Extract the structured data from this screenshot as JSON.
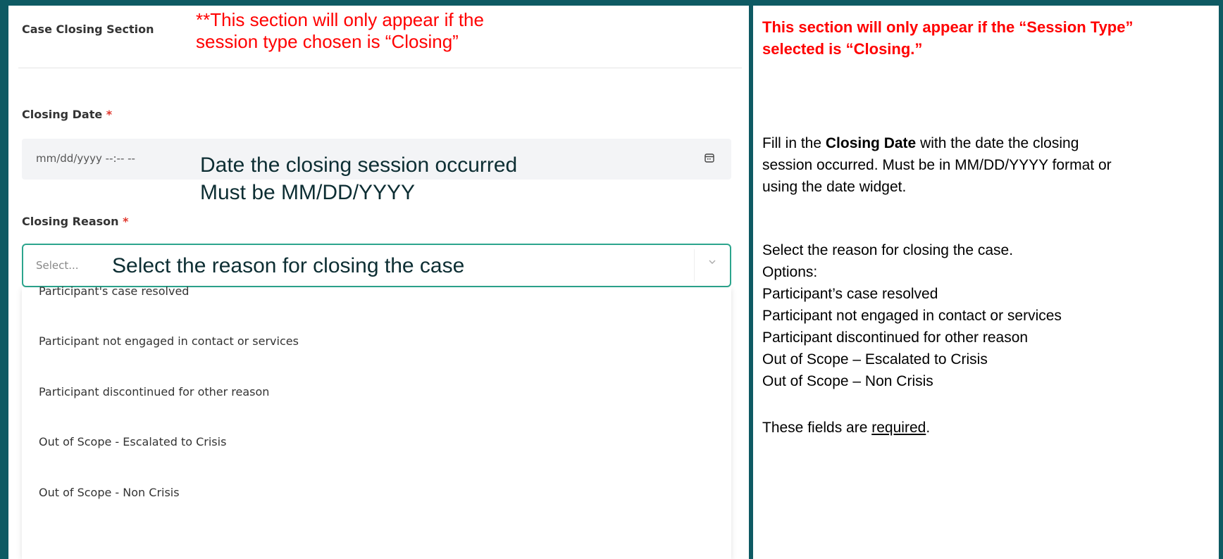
{
  "left": {
    "section_title": "Case Closing Section",
    "annotation_line1": "**This section will only appear if the",
    "annotation_line2": "session type chosen is “Closing”",
    "closing_date": {
      "label": "Closing Date",
      "required_mark": "*",
      "placeholder": "mm/dd/yyyy --:-- --",
      "note_line1": "Date the closing session occurred",
      "note_line2": "Must be MM/DD/YYYY"
    },
    "closing_reason": {
      "label": "Closing Reason",
      "required_mark": "*",
      "placeholder": "Select...",
      "note": "Select the reason for closing the case",
      "options": [
        "Participant's case resolved",
        "Participant not engaged in contact or services",
        "Participant discontinued for other reason",
        "Out of Scope - Escalated to Crisis",
        "Out of Scope - Non Crisis"
      ]
    }
  },
  "right": {
    "header_line1": "This section will only appear if the “Session Type”",
    "header_line2": "selected is “Closing.”",
    "date_text": {
      "pre": "Fill in the ",
      "bold": "Closing Date",
      "post": " with the date the closing",
      "line2": "session occurred.  Must be in MM/DD/YYYY format or",
      "line3": "using the date widget."
    },
    "reason_text": {
      "line1": "Select the reason for closing the case.",
      "options_label": "Options:",
      "options": [
        "Participant’s case resolved",
        "Participant not engaged in contact or services",
        "Participant discontinued for other reason",
        "Out of Scope – Escalated to Crisis",
        "Out of Scope – Non Crisis"
      ]
    },
    "required_text": {
      "pre": "These fields are ",
      "underlined": "required",
      "post": "."
    }
  },
  "colors": {
    "frame": "#0e5a63",
    "annotation_red": "#ff0000",
    "select_border": "#2ca58d",
    "required_star": "#e0352b"
  },
  "icons": [
    "calendar-icon",
    "chevron-down-icon"
  ]
}
